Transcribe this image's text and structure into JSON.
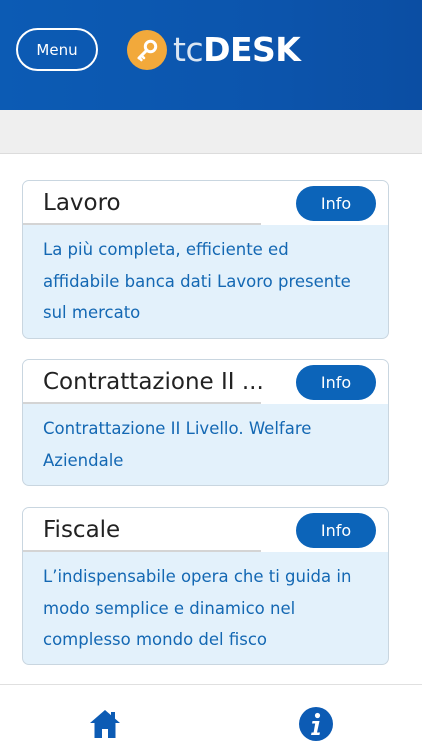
{
  "header": {
    "menu_label": "Menu",
    "logo_light": "tc",
    "logo_bold": "DESK",
    "logo_icon": "key-icon"
  },
  "colors": {
    "header_bg": "#0c5bb4",
    "accent_orange": "#f2a93b",
    "button_blue": "#0c64b9",
    "card_bg": "#e3f1fb",
    "desc_text": "#1468b3"
  },
  "cards": [
    {
      "title": "Lavoro",
      "button": "Info",
      "desc_lines": [
        "La più completa, efficiente ed",
        "affidabile banca dati Lavoro presente",
        "sul mercato"
      ]
    },
    {
      "title": "Contrattazione II ...",
      "button": "Info",
      "desc_lines": [
        "Contrattazione II Livello. Welfare",
        "Aziendale"
      ]
    },
    {
      "title": "Fiscale",
      "button": "Info",
      "desc_lines": [
        "L’indispensabile opera che ti guida in",
        "modo semplice e dinamico nel",
        "complesso mondo del fisco"
      ]
    }
  ],
  "tabbar": {
    "items": [
      {
        "icon": "home-icon"
      },
      {
        "icon": "info-icon"
      }
    ]
  }
}
